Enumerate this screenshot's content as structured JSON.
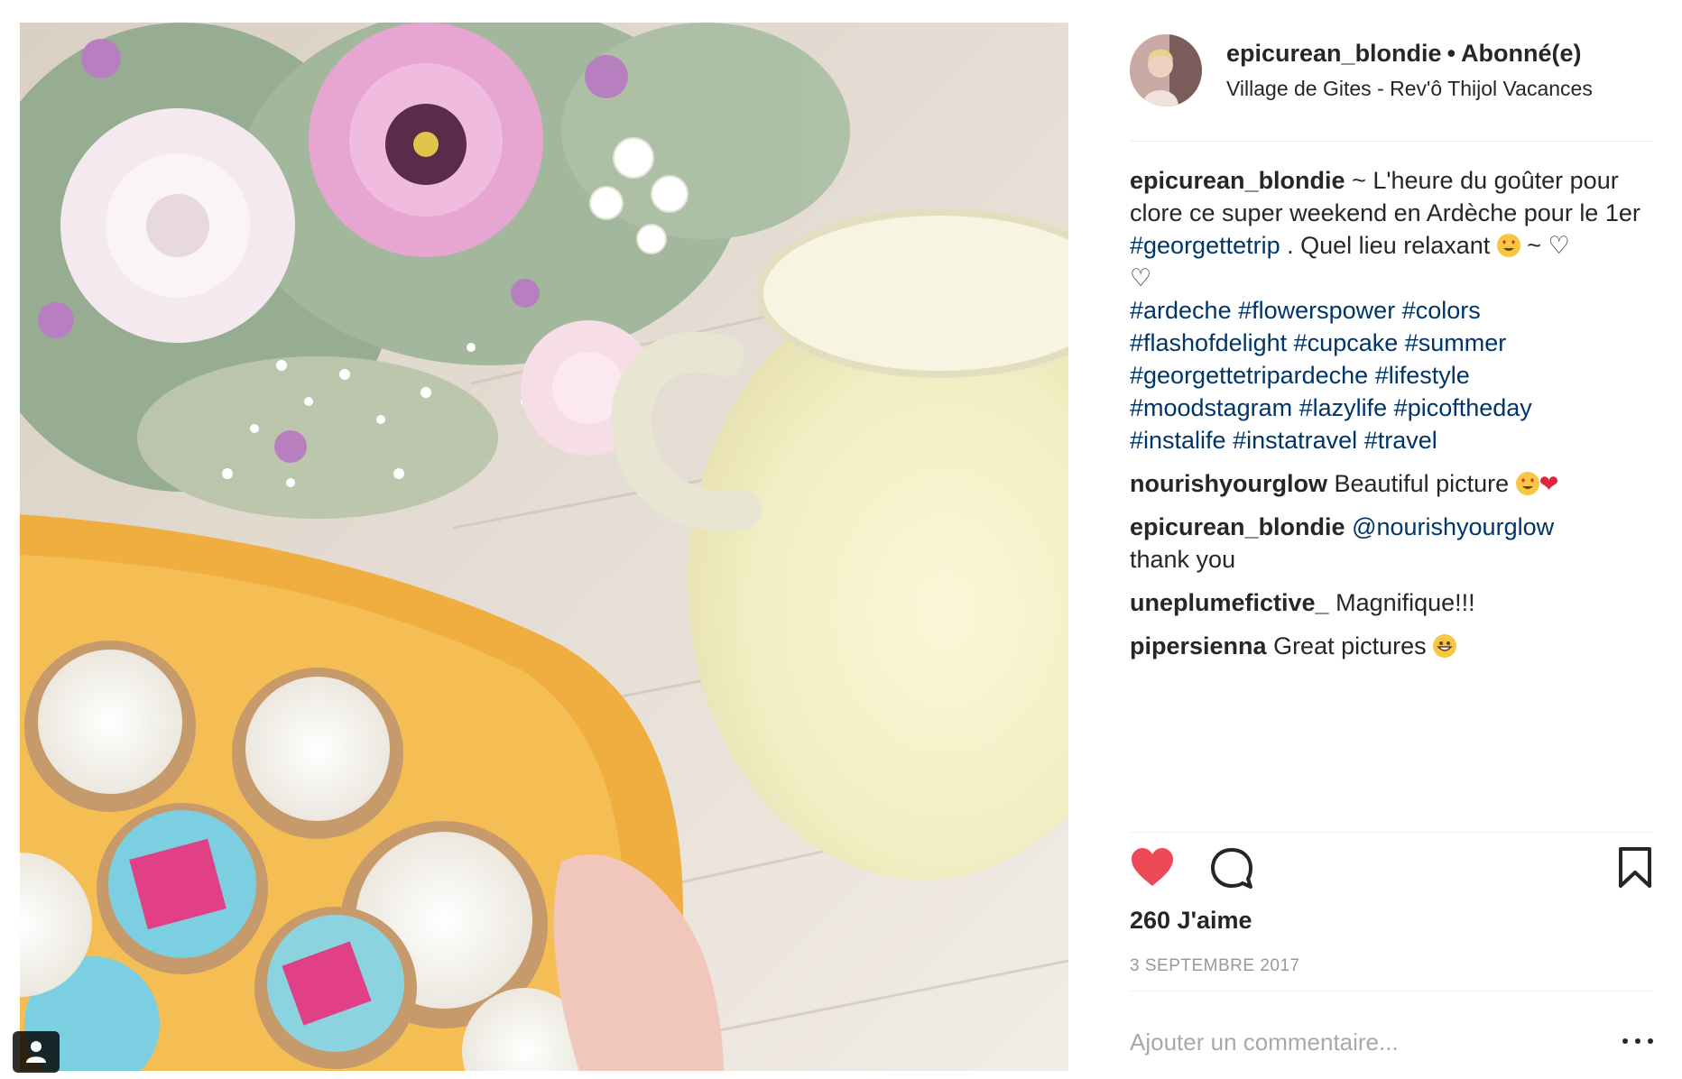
{
  "post": {
    "username": "epicurean_blondie",
    "separator": "•",
    "follow_status": "Abonné(e)",
    "location": "Village de Gites - Rev'ô Thijol Vacances"
  },
  "caption": {
    "username": "epicurean_blondie",
    "text_1": "~ L'heure du goûter pour clore ce super weekend en Ardèche pour le 1er",
    "tag_1": "#georgettetrip",
    "text_2": ". Quel lieu relaxant",
    "text_3": "~ ♡",
    "text_4": "♡",
    "hashtags": [
      "#ardeche",
      "#flowerspower",
      "#colors",
      "#flashofdelight",
      "#cupcake",
      "#summer",
      "#georgettetripardeche",
      "#lifestyle",
      "#moodstagram",
      "#lazylife",
      "#picoftheday",
      "#instalife",
      "#instatravel",
      "#travel"
    ]
  },
  "comments": [
    {
      "username": "nourishyourglow",
      "text": "Beautiful picture",
      "emojis": [
        "heart-eyes-emoji",
        "red-heart-emoji"
      ]
    },
    {
      "username": "epicurean_blondie",
      "mention": "@nourishyourglow",
      "text": "thank you"
    },
    {
      "username": "uneplumefictive_",
      "text": "Magnifique!!!"
    },
    {
      "username": "pipersienna",
      "text": "Great pictures",
      "emojis": [
        "grinning-emoji"
      ]
    }
  ],
  "actions": {
    "like_icon": "heart-icon",
    "comment_icon": "speech-bubble-icon",
    "save_icon": "bookmark-icon",
    "liked": true,
    "like_color": "#ed4956"
  },
  "likes_text": "260 J'aime",
  "date_text": "3 SEPTEMBRE 2017",
  "add_comment": {
    "placeholder": "Ajouter un commentaire..."
  },
  "photo": {
    "tag_icon": "person-icon"
  },
  "colors": {
    "text": "#262626",
    "hashtag": "#003569",
    "muted": "#999999",
    "divider": "#efefef"
  }
}
